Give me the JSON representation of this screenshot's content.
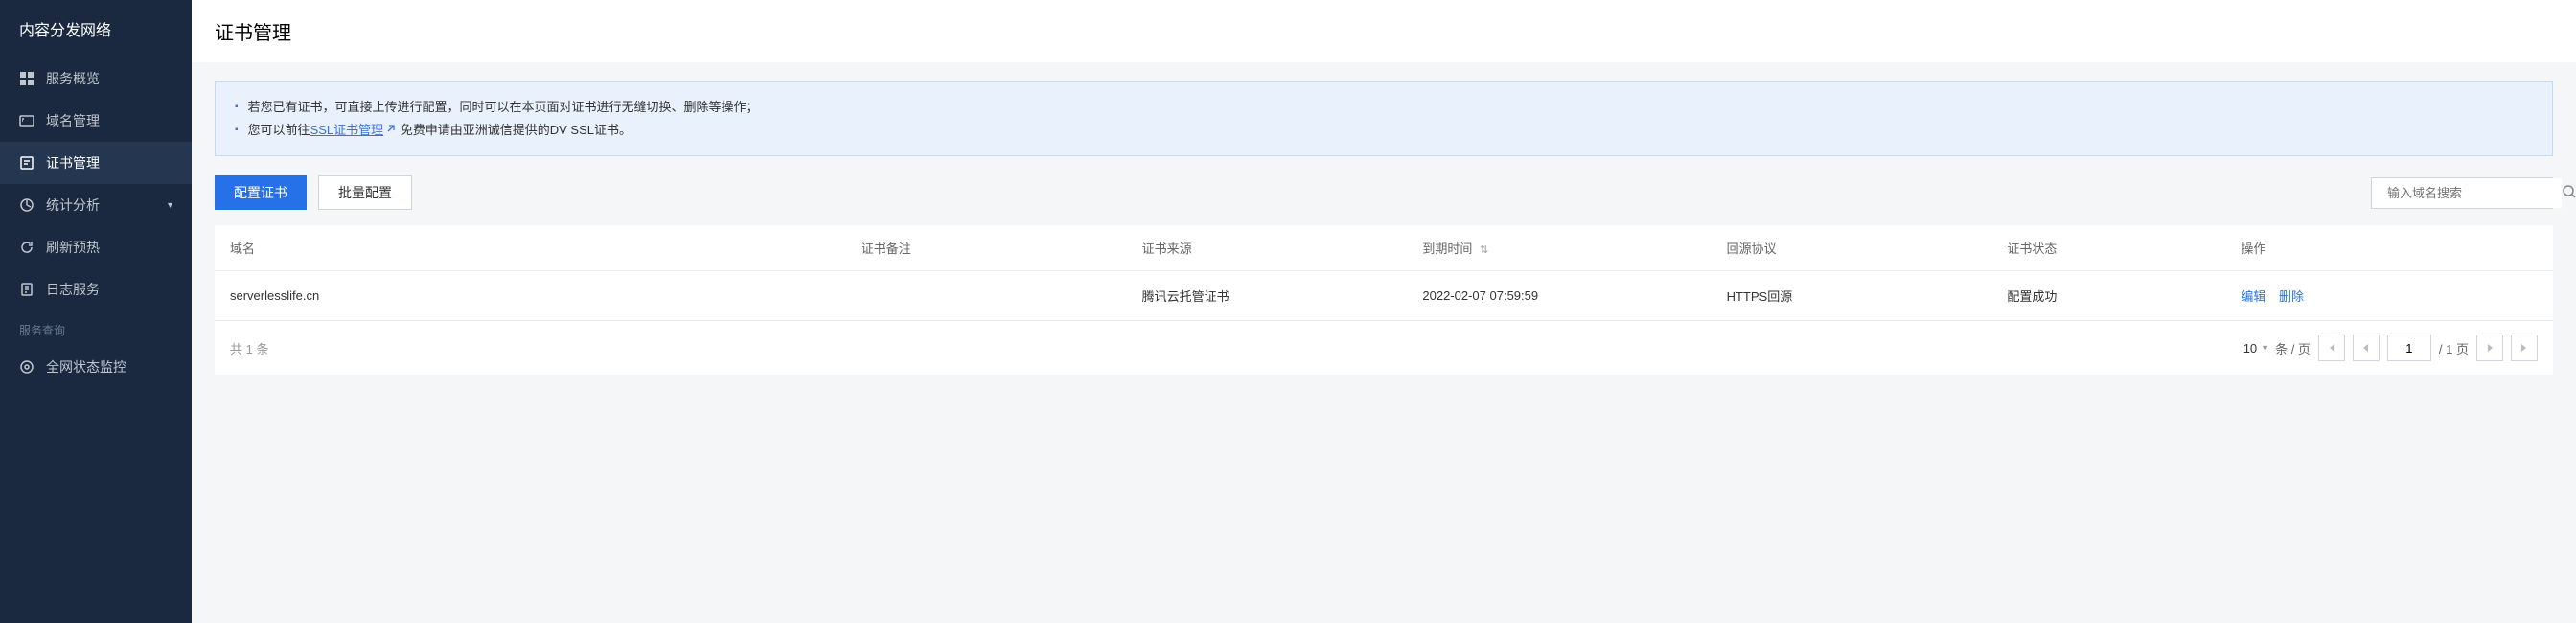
{
  "sidebar": {
    "title": "内容分发网络",
    "items": [
      {
        "label": "服务概览",
        "icon": "overview"
      },
      {
        "label": "域名管理",
        "icon": "domain"
      },
      {
        "label": "证书管理",
        "icon": "cert",
        "active": true
      },
      {
        "label": "统计分析",
        "icon": "stats",
        "expandable": true
      },
      {
        "label": "刷新预热",
        "icon": "refresh"
      },
      {
        "label": "日志服务",
        "icon": "log"
      }
    ],
    "section_title": "服务查询",
    "section_items": [
      {
        "label": "全网状态监控",
        "icon": "monitor"
      }
    ]
  },
  "page": {
    "title": "证书管理"
  },
  "info": {
    "line1": "若您已有证书，可直接上传进行配置，同时可以在本页面对证书进行无缝切换、删除等操作；",
    "line2_pre": "您可以前往",
    "line2_link": "SSL证书管理",
    "line2_post": "免费申请由亚洲诚信提供的DV SSL证书。"
  },
  "actions": {
    "configure": "配置证书",
    "batch": "批量配置"
  },
  "search": {
    "placeholder": "输入域名搜索"
  },
  "table": {
    "headers": {
      "domain": "域名",
      "remark": "证书备注",
      "source": "证书来源",
      "expire": "到期时间",
      "origin_proto": "回源协议",
      "status": "证书状态",
      "action": "操作"
    },
    "rows": [
      {
        "domain": "serverlesslife.cn",
        "remark": "",
        "source": "腾讯云托管证书",
        "expire": "2022-02-07 07:59:59",
        "origin_proto": "HTTPS回源",
        "status": "配置成功",
        "edit": "编辑",
        "delete": "删除"
      }
    ]
  },
  "pagination": {
    "total_pre": "共",
    "total_count": "1",
    "total_suf": "条",
    "page_size": "10",
    "per_page": "条 / 页",
    "current": "1",
    "total_pages": "/ 1 页"
  }
}
